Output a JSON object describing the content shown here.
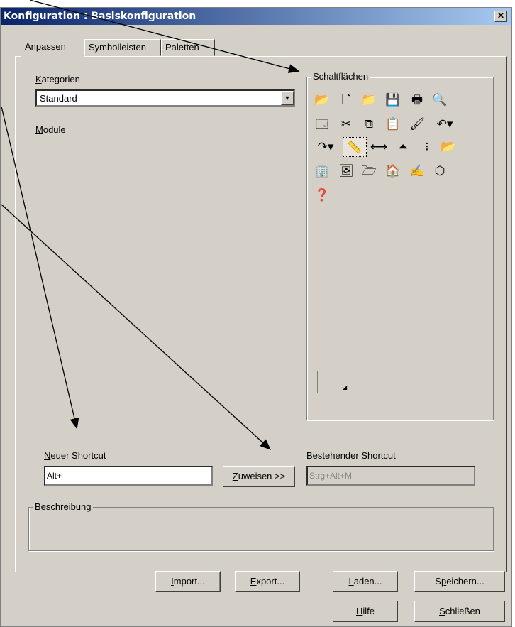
{
  "window": {
    "title": "Konfiguration : Basiskonfiguration",
    "close_glyph": "✕"
  },
  "tabs": [
    {
      "label": "Anpassen",
      "active": true
    },
    {
      "label": "Symbolleisten",
      "active": false
    },
    {
      "label": "Paletten",
      "active": false
    }
  ],
  "kategorien": {
    "label_first": "K",
    "label_rest": "ategorien",
    "selected": "Standard"
  },
  "module": {
    "label_first": "M",
    "label_rest": "odule"
  },
  "schaltflaechen": {
    "title": "Schaltflächen",
    "icons": [
      [
        "open-project-icon",
        "new-document-icon",
        "open-folder-icon",
        "save-icon",
        "print-icon",
        "print-preview-icon"
      ],
      [
        "window-icon",
        "cut-icon",
        "copy-icon",
        "paste-icon",
        "format-painter-icon",
        "undo-icon"
      ],
      [
        "redo-icon",
        "measure-tool-icon",
        "dimension-icon",
        "elevation-icon",
        "marker-icon",
        "import-icon"
      ],
      [
        "building-icon",
        "image-icon",
        "text-folder-icon",
        "property-icon",
        "draw-icon",
        "3d-object-icon"
      ],
      [
        "help-icon"
      ]
    ],
    "selected_icon": "measure-tool-icon"
  },
  "neuer_shortcut": {
    "label_first": "N",
    "label_rest": "euer Shortcut",
    "value": "Alt+"
  },
  "zuweisen_button": {
    "label_first": "Z",
    "label_rest": "uweisen >>"
  },
  "bestehender_shortcut": {
    "label": "Bestehender Shortcut",
    "value": "Strg+Alt+M"
  },
  "beschreibung": {
    "title": "Beschreibung"
  },
  "buttons": {
    "import": {
      "first": "I",
      "rest": "mport..."
    },
    "export": {
      "first": "E",
      "rest": "xport..."
    },
    "laden": {
      "first": "L",
      "rest": "aden..."
    },
    "speichern": {
      "pre": "S",
      "first": "p",
      "rest": "eichern..."
    },
    "hilfe": {
      "first": "H",
      "rest": "ilfe"
    },
    "schliessen": {
      "first": "S",
      "rest": "chließen"
    }
  }
}
